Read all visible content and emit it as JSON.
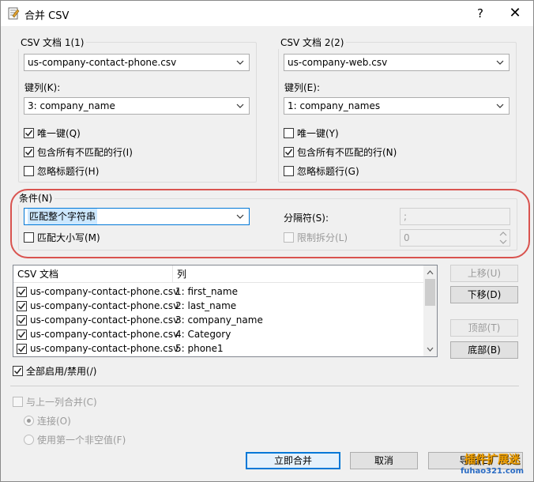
{
  "window": {
    "title": "合并 CSV",
    "help_label": "?",
    "close_label": "✕"
  },
  "csv1": {
    "legend": "CSV 文档 1(1)",
    "file": "us-company-contact-phone.csv",
    "key_label": "键列(K):",
    "key_value": "3: company_name",
    "unique_key": {
      "label": "唯一键(Q)",
      "checked": true
    },
    "include_unmatched": {
      "label": "包含所有不匹配的行(I)",
      "checked": true
    },
    "ignore_header": {
      "label": "忽略标题行(H)",
      "checked": false
    }
  },
  "csv2": {
    "legend": "CSV 文档 2(2)",
    "file": "us-company-web.csv",
    "key_label": "键列(E):",
    "key_value": "1: company_names",
    "unique_key": {
      "label": "唯一键(Y)",
      "checked": false
    },
    "include_unmatched": {
      "label": "包含所有不匹配的行(N)",
      "checked": true
    },
    "ignore_header": {
      "label": "忽略标题行(G)",
      "checked": false
    }
  },
  "condition": {
    "legend": "条件(N)",
    "match_mode": "匹配整个字符串",
    "match_case": {
      "label": "匹配大小写(M)",
      "checked": false
    },
    "separator_label": "分隔符(S):",
    "separator_value": ";",
    "limit_split": {
      "label": "限制拆分(L)",
      "checked": false
    },
    "limit_value": "0"
  },
  "columns_list": {
    "headers": [
      "CSV 文档",
      "列"
    ],
    "rows": [
      {
        "doc": "us-company-contact-phone.csv",
        "col": "1: first_name",
        "checked": true
      },
      {
        "doc": "us-company-contact-phone.csv",
        "col": "2: last_name",
        "checked": true
      },
      {
        "doc": "us-company-contact-phone.csv",
        "col": "3: company_name",
        "checked": true
      },
      {
        "doc": "us-company-contact-phone.csv",
        "col": "4: Category",
        "checked": true
      },
      {
        "doc": "us-company-contact-phone.csv",
        "col": "5: phone1",
        "checked": true
      }
    ],
    "up_label": "上移(U)",
    "down_label": "下移(D)",
    "top_label": "顶部(T)",
    "bottom_label": "底部(B)",
    "toggle_all": {
      "label": "全部启用/禁用(/)",
      "checked": true
    }
  },
  "merge_prev": {
    "label": "与上一列合并(C)",
    "checked": false,
    "concat_label": "连接(O)",
    "first_nonempty_label": "使用第一个非空值(F)"
  },
  "footer": {
    "merge_now": "立即合并",
    "cancel": "取消",
    "export": "导出(E)"
  },
  "watermark": {
    "line1": "插件扩展迷",
    "line2": "fuhao321.com"
  },
  "colors": {
    "accent": "#0078d7",
    "highlight_ring": "#d9534f"
  }
}
